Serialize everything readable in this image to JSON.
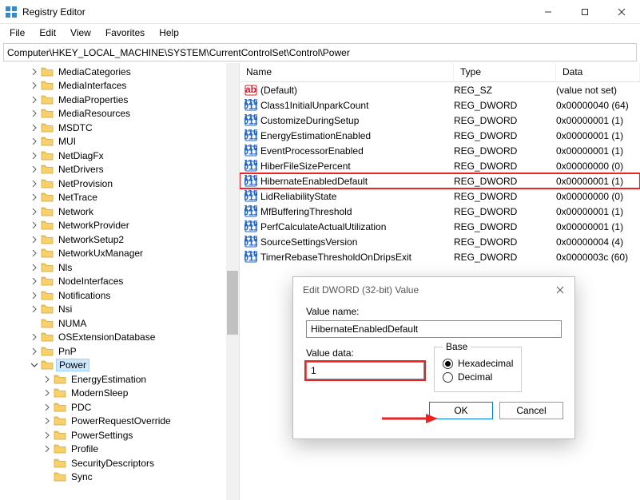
{
  "window": {
    "title": "Registry Editor"
  },
  "menubar": [
    "File",
    "Edit",
    "View",
    "Favorites",
    "Help"
  ],
  "address": "Computer\\HKEY_LOCAL_MACHINE\\SYSTEM\\CurrentControlSet\\Control\\Power",
  "tree": [
    {
      "label": "MediaCategories",
      "indent": 2,
      "expand": ">"
    },
    {
      "label": "MediaInterfaces",
      "indent": 2,
      "expand": ">"
    },
    {
      "label": "MediaProperties",
      "indent": 2,
      "expand": ">"
    },
    {
      "label": "MediaResources",
      "indent": 2,
      "expand": ">"
    },
    {
      "label": "MSDTC",
      "indent": 2,
      "expand": ">"
    },
    {
      "label": "MUI",
      "indent": 2,
      "expand": ">"
    },
    {
      "label": "NetDiagFx",
      "indent": 2,
      "expand": ">"
    },
    {
      "label": "NetDrivers",
      "indent": 2,
      "expand": ">"
    },
    {
      "label": "NetProvision",
      "indent": 2,
      "expand": ">"
    },
    {
      "label": "NetTrace",
      "indent": 2,
      "expand": ">"
    },
    {
      "label": "Network",
      "indent": 2,
      "expand": ">"
    },
    {
      "label": "NetworkProvider",
      "indent": 2,
      "expand": ">"
    },
    {
      "label": "NetworkSetup2",
      "indent": 2,
      "expand": ">"
    },
    {
      "label": "NetworkUxManager",
      "indent": 2,
      "expand": ">"
    },
    {
      "label": "Nls",
      "indent": 2,
      "expand": ">"
    },
    {
      "label": "NodeInterfaces",
      "indent": 2,
      "expand": ">"
    },
    {
      "label": "Notifications",
      "indent": 2,
      "expand": ">"
    },
    {
      "label": "Nsi",
      "indent": 2,
      "expand": ">"
    },
    {
      "label": "NUMA",
      "indent": 2,
      "expand": ""
    },
    {
      "label": "OSExtensionDatabase",
      "indent": 2,
      "expand": ">"
    },
    {
      "label": "PnP",
      "indent": 2,
      "expand": ">"
    },
    {
      "label": "Power",
      "indent": 2,
      "expand": "v",
      "selected": true
    },
    {
      "label": "EnergyEstimation",
      "indent": 3,
      "expand": ">"
    },
    {
      "label": "ModernSleep",
      "indent": 3,
      "expand": ">"
    },
    {
      "label": "PDC",
      "indent": 3,
      "expand": ">"
    },
    {
      "label": "PowerRequestOverride",
      "indent": 3,
      "expand": ">"
    },
    {
      "label": "PowerSettings",
      "indent": 3,
      "expand": ">"
    },
    {
      "label": "Profile",
      "indent": 3,
      "expand": ">"
    },
    {
      "label": "SecurityDescriptors",
      "indent": 3,
      "expand": ""
    },
    {
      "label": "Sync",
      "indent": 3,
      "expand": ""
    }
  ],
  "columns": {
    "name": "Name",
    "type": "Type",
    "data": "Data"
  },
  "values": [
    {
      "icon": "sz",
      "name": "(Default)",
      "type": "REG_SZ",
      "data": "(value not set)"
    },
    {
      "icon": "bin",
      "name": "Class1InitialUnparkCount",
      "type": "REG_DWORD",
      "data": "0x00000040 (64)"
    },
    {
      "icon": "bin",
      "name": "CustomizeDuringSetup",
      "type": "REG_DWORD",
      "data": "0x00000001 (1)"
    },
    {
      "icon": "bin",
      "name": "EnergyEstimationEnabled",
      "type": "REG_DWORD",
      "data": "0x00000001 (1)"
    },
    {
      "icon": "bin",
      "name": "EventProcessorEnabled",
      "type": "REG_DWORD",
      "data": "0x00000001 (1)"
    },
    {
      "icon": "bin",
      "name": "HiberFileSizePercent",
      "type": "REG_DWORD",
      "data": "0x00000000 (0)"
    },
    {
      "icon": "bin",
      "name": "HibernateEnabledDefault",
      "type": "REG_DWORD",
      "data": "0x00000001 (1)",
      "hl": true
    },
    {
      "icon": "bin",
      "name": "LidReliabilityState",
      "type": "REG_DWORD",
      "data": "0x00000000 (0)"
    },
    {
      "icon": "bin",
      "name": "MfBufferingThreshold",
      "type": "REG_DWORD",
      "data": "0x00000001 (1)"
    },
    {
      "icon": "bin",
      "name": "PerfCalculateActualUtilization",
      "type": "REG_DWORD",
      "data": "0x00000001 (1)"
    },
    {
      "icon": "bin",
      "name": "SourceSettingsVersion",
      "type": "REG_DWORD",
      "data": "0x00000004 (4)"
    },
    {
      "icon": "bin",
      "name": "TimerRebaseThresholdOnDripsExit",
      "type": "REG_DWORD",
      "data": "0x0000003c (60)"
    }
  ],
  "dialog": {
    "title": "Edit DWORD (32-bit) Value",
    "name_label": "Value name:",
    "name_value": "HibernateEnabledDefault",
    "data_label": "Value data:",
    "data_value": "1",
    "base_label": "Base",
    "hex_label": "Hexadecimal",
    "dec_label": "Decimal",
    "base_selected": "hex",
    "ok": "OK",
    "cancel": "Cancel"
  }
}
